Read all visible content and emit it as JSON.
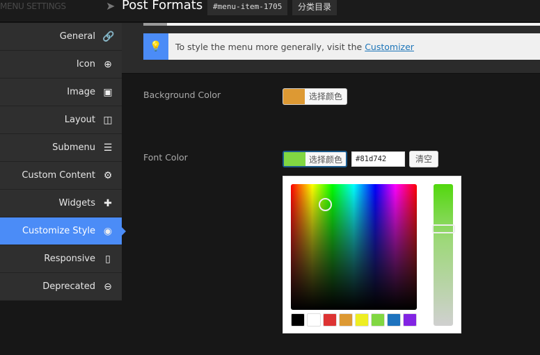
{
  "header": {
    "section_label": "MENU SETTINGS",
    "title": "Post Formats",
    "menu_item_id": "#menu-item-1705",
    "category": "分类目录"
  },
  "sidebar": {
    "items": [
      {
        "label": "General",
        "icon": "link-icon",
        "glyph": "🔗"
      },
      {
        "label": "Icon",
        "icon": "plus-circle-icon",
        "glyph": "⊕"
      },
      {
        "label": "Image",
        "icon": "image-icon",
        "glyph": "▣"
      },
      {
        "label": "Layout",
        "icon": "columns-icon",
        "glyph": "◫"
      },
      {
        "label": "Submenu",
        "icon": "list-icon",
        "glyph": "☰"
      },
      {
        "label": "Custom Content",
        "icon": "cogs-icon",
        "glyph": "⚙"
      },
      {
        "label": "Widgets",
        "icon": "puzzle-icon",
        "glyph": "✚"
      },
      {
        "label": "Customize Style",
        "icon": "eye-icon",
        "glyph": "◉",
        "active": true
      },
      {
        "label": "Responsive",
        "icon": "mobile-icon",
        "glyph": "▯"
      },
      {
        "label": "Deprecated",
        "icon": "minus-circle-icon",
        "glyph": "⊖"
      }
    ]
  },
  "notice": {
    "text": "To style the menu more generally, visit the",
    "link": "Customizer",
    "icon": "lightbulb-icon"
  },
  "background_color": {
    "label": "Background Color",
    "button": "选择颜色",
    "value": "#dd9933"
  },
  "font_color": {
    "label": "Font Color",
    "button": "选择颜色",
    "value": "#81d742",
    "clear": "清空"
  },
  "palette": [
    "#000000",
    "#ffffff",
    "#dd3333",
    "#dd9933",
    "#eeee22",
    "#81d742",
    "#1e73be",
    "#8224e3"
  ],
  "colors": {
    "accent": "#4b8cf7"
  }
}
